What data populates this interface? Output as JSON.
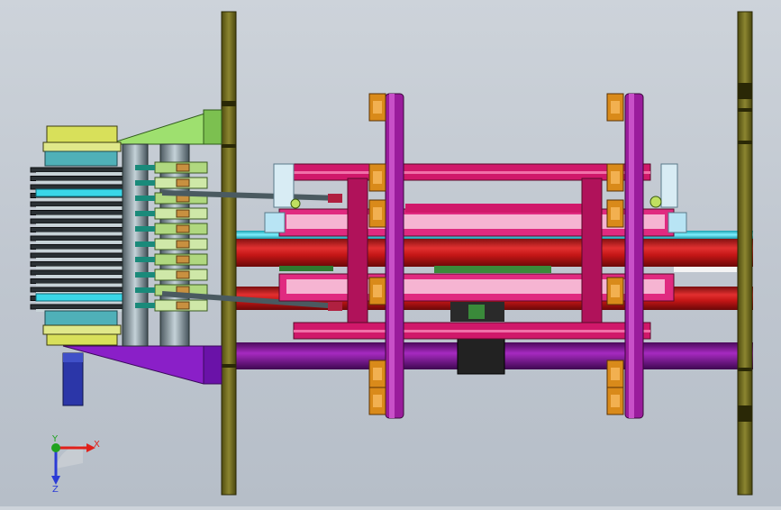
{
  "window": {
    "title": ""
  },
  "viewport": {
    "background_top": "#cdd3da",
    "background_bottom": "#b6bec8"
  },
  "triad": {
    "x_label": "X",
    "y_label": "Y",
    "z_label": "Z",
    "x_color": "#e0201a",
    "y_color": "#1fa21f",
    "z_color": "#2b3bd6"
  },
  "colors": {
    "olive_plate": "#6f6a1e",
    "magenta_frame": "#d0186a",
    "pink_light": "#f4a9c8",
    "red_shaft": "#c81818",
    "purple_shaft": "#8a1a9c",
    "cyan_shaft": "#3cc8d8",
    "orange_clamp": "#d98a1a",
    "green_bracket": "#9ad86a",
    "steel": "#7a8c95",
    "blue_post": "#2b36a8"
  }
}
